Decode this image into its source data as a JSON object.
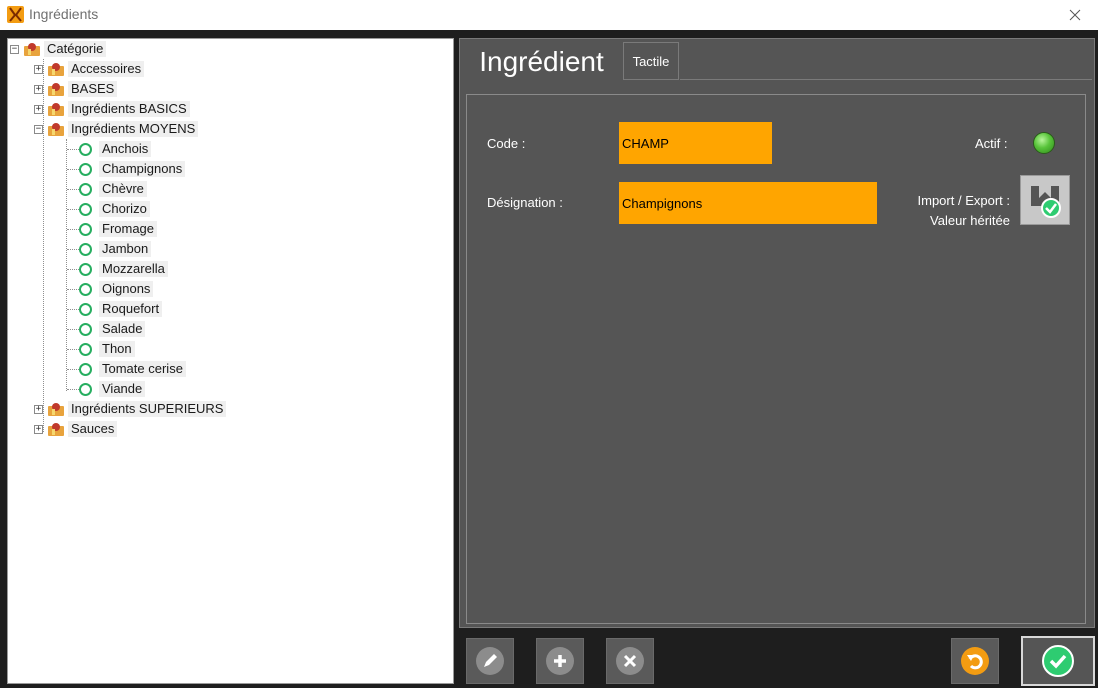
{
  "window": {
    "title": "Ingrédients"
  },
  "tree": {
    "root": {
      "label": "Catégorie"
    },
    "categories": [
      {
        "label": "Accessoires",
        "expanded": false
      },
      {
        "label": "BASES",
        "expanded": false
      },
      {
        "label": "Ingrédients BASICS",
        "expanded": false
      },
      {
        "label": "Ingrédients MOYENS",
        "expanded": true
      },
      {
        "label": "Ingrédients SUPERIEURS",
        "expanded": false
      },
      {
        "label": "Sauces",
        "expanded": false
      }
    ],
    "items": [
      "Anchois",
      "Champignons",
      "Chèvre",
      "Chorizo",
      "Fromage",
      "Jambon",
      "Mozzarella",
      "Oignons",
      "Roquefort",
      "Salade",
      "Thon",
      "Tomate cerise",
      "Viande"
    ]
  },
  "tabs": {
    "active": "Ingrédient",
    "inactive": "Tactile"
  },
  "form": {
    "code_label": "Code :",
    "code_value": "CHAMP",
    "designation_label": "Désignation :",
    "designation_value": "Champignons",
    "active_label": "Actif :",
    "import_export_label": "Import / Export :",
    "inherited_label": "Valeur héritée"
  },
  "colors": {
    "field_bg": "#ffa500",
    "panel_bg": "#555555",
    "active_led": "#58c43a",
    "leaf_icon": "#27ae60"
  },
  "icons": {
    "edit": "pencil-icon",
    "add": "plus-icon",
    "delete": "cross-icon",
    "undo": "undo-icon",
    "confirm": "checkmark-icon",
    "import_export": "import-export-icon"
  }
}
